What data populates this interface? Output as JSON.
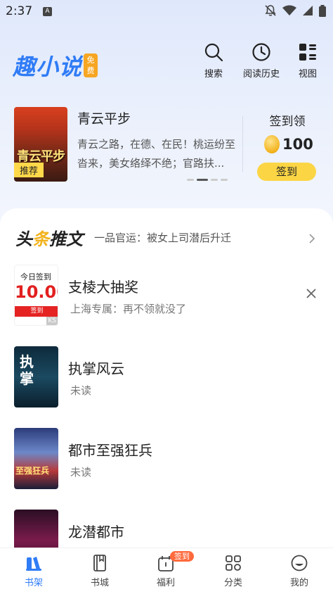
{
  "status_bar": {
    "time": "2:37",
    "notification_badge": "A"
  },
  "header": {
    "logo_text": "趣小说",
    "logo_badge": "免费",
    "search_label": "搜索",
    "history_label": "阅读历史",
    "view_label": "视图"
  },
  "recommend": {
    "cover_title": "青云平步",
    "cover_tag": "推荐",
    "title": "青云平步",
    "description": "青云之路，在德、在民！桃运纷至沓来，美女络绎不绝；官路扶...",
    "checkin_title": "签到领",
    "coins": "100",
    "checkin_button": "签到"
  },
  "headline": {
    "title_part1": "头",
    "title_accent": "条",
    "title_part2": "推文",
    "subtitle": "一品官运：被女上司潜后升迁"
  },
  "books": [
    {
      "name": "支棱大抽奖",
      "sub": "上海专属：再不领就没了",
      "ad_line1": "今日签到",
      "ad_amount": "10.00",
      "ad_button": "签到",
      "ad_mark": "KS"
    },
    {
      "name": "执掌风云",
      "sub": "未读",
      "cover_text": "执掌"
    },
    {
      "name": "都市至强狂兵",
      "sub": "未读",
      "cover_text": "至强狂兵"
    },
    {
      "name": "龙潜都市",
      "sub": "",
      "cover_text": ""
    }
  ],
  "bottom_nav": {
    "shelf": "书架",
    "store": "书城",
    "welfare": "福利",
    "welfare_badge": "签到",
    "category": "分类",
    "mine": "我的"
  },
  "colors": {
    "accent": "#2f7cf6",
    "gold": "#fbd544",
    "badge": "#ff6a3d"
  }
}
